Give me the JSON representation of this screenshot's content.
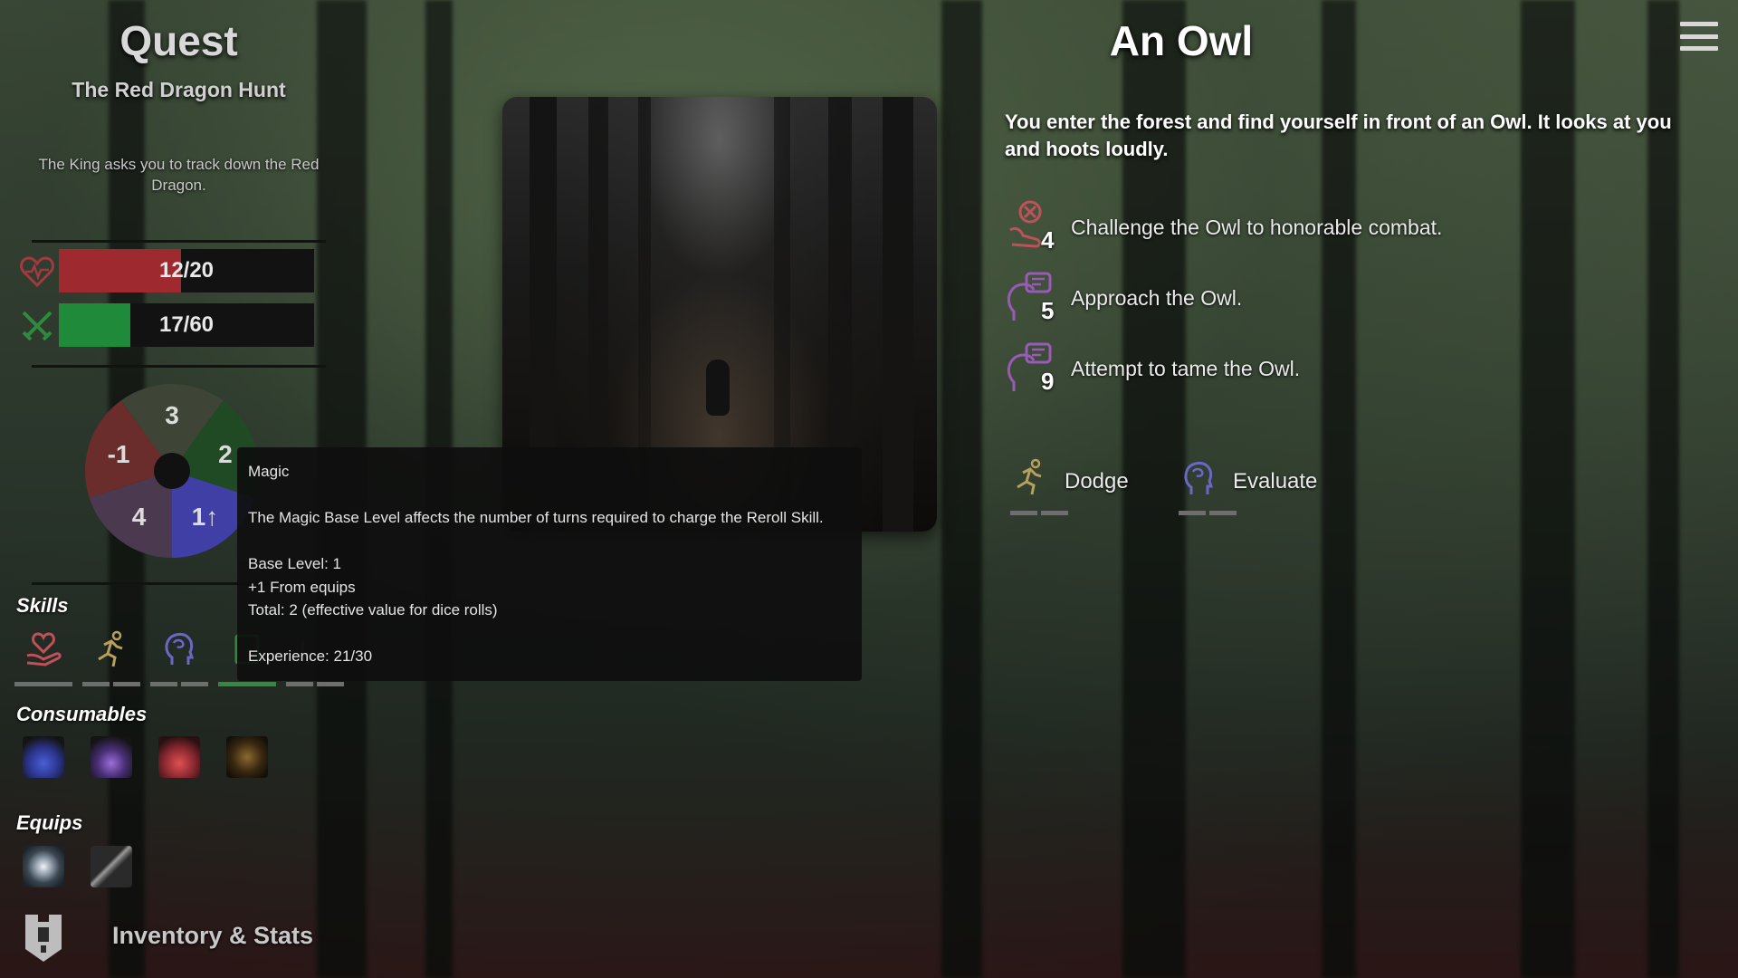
{
  "quest": {
    "heading": "Quest",
    "name": "The Red Dragon Hunt",
    "description": "The King asks you to track down the Red Dragon."
  },
  "health": {
    "text": "12/20",
    "fraction": 0.48,
    "color": "#9e2a30",
    "icon": "heart-icon"
  },
  "stamina": {
    "text": "17/60",
    "fraction": 0.28,
    "color": "#1f8a3a",
    "icon": "crossed-swords-icon"
  },
  "attribute_wheel": [
    {
      "label": "3",
      "color": "#3e4536",
      "icon": "bow-icon"
    },
    {
      "label": "2",
      "color": "#1f4a24",
      "icon": "leaf-icon"
    },
    {
      "label": "1↑",
      "color": "#3f3fa6",
      "icon": "brain-icon"
    },
    {
      "label": "4",
      "color": "#4b3a4f",
      "icon": "dumbbell-icon"
    },
    {
      "label": "-1",
      "color": "#6b2c2c",
      "icon": "heart-shield-icon"
    }
  ],
  "skills": {
    "label": "Skills",
    "items": [
      {
        "icon": "heart-hand-icon",
        "color": "#c0505a",
        "pips": [
          "#7a7a7a"
        ]
      },
      {
        "icon": "running-man-icon",
        "color": "#b7a05c",
        "pips": [
          "#7a7a7a",
          "#7a7a7a"
        ]
      },
      {
        "icon": "brain-head-icon",
        "color": "#6a67c7",
        "pips": [
          "#7a7a7a",
          "#7a7a7a"
        ]
      },
      {
        "icon": "book-icon",
        "color": "#2f8a3f",
        "pips": [
          "#2f8a3f"
        ]
      },
      {
        "icon": "speech-head-icon",
        "color": "#8a5aa8",
        "pips": [
          "#7a7a7a",
          "#7a7a7a"
        ]
      }
    ]
  },
  "consumables": {
    "label": "Consumables",
    "items": [
      {
        "icon": "blue-potion-icon",
        "color": "#3b4fb8"
      },
      {
        "icon": "purple-potion-icon",
        "color": "#7a4fa8"
      },
      {
        "icon": "red-potion-icon",
        "color": "#b8303a"
      },
      {
        "icon": "dark-scroll-icon",
        "color": "#6a4a20"
      }
    ]
  },
  "equips": {
    "label": "Equips",
    "items": [
      {
        "icon": "lantern-icon",
        "color": "#cfd6dc"
      },
      {
        "icon": "dagger-icon",
        "color": "#8a8a8a"
      }
    ]
  },
  "inventory": {
    "label": "Inventory & Stats",
    "icon": "armor-icon"
  },
  "tooltip": {
    "title": "Magic",
    "description": "The Magic Base Level affects the number of turns required to charge the Reroll Skill.",
    "base_level": "Base Level: 1",
    "from_equips": "+1 From equips",
    "total": "Total: 2 (effective value for dice rolls)",
    "experience": "Experience: 21/30"
  },
  "event": {
    "title": "An Owl",
    "description": "You enter the forest and find yourself in front of an Owl. It looks at you and hoots loudly.",
    "choices": [
      {
        "icon": "combat-icon",
        "color": "#c0505a",
        "number": "4",
        "text": "Challenge the Owl to honorable combat."
      },
      {
        "icon": "speech-head-icon",
        "color": "#9a5ab8",
        "number": "5",
        "text": "Approach the Owl."
      },
      {
        "icon": "speech-head-icon",
        "color": "#9a5ab8",
        "number": "9",
        "text": "Attempt to tame the Owl."
      }
    ],
    "actions": [
      {
        "icon": "running-man-icon",
        "color": "#b7a05c",
        "label": "Dodge"
      },
      {
        "icon": "brain-head-icon",
        "color": "#6a67c7",
        "label": "Evaluate"
      }
    ]
  },
  "menu": {
    "icon": "hamburger-menu-icon"
  }
}
